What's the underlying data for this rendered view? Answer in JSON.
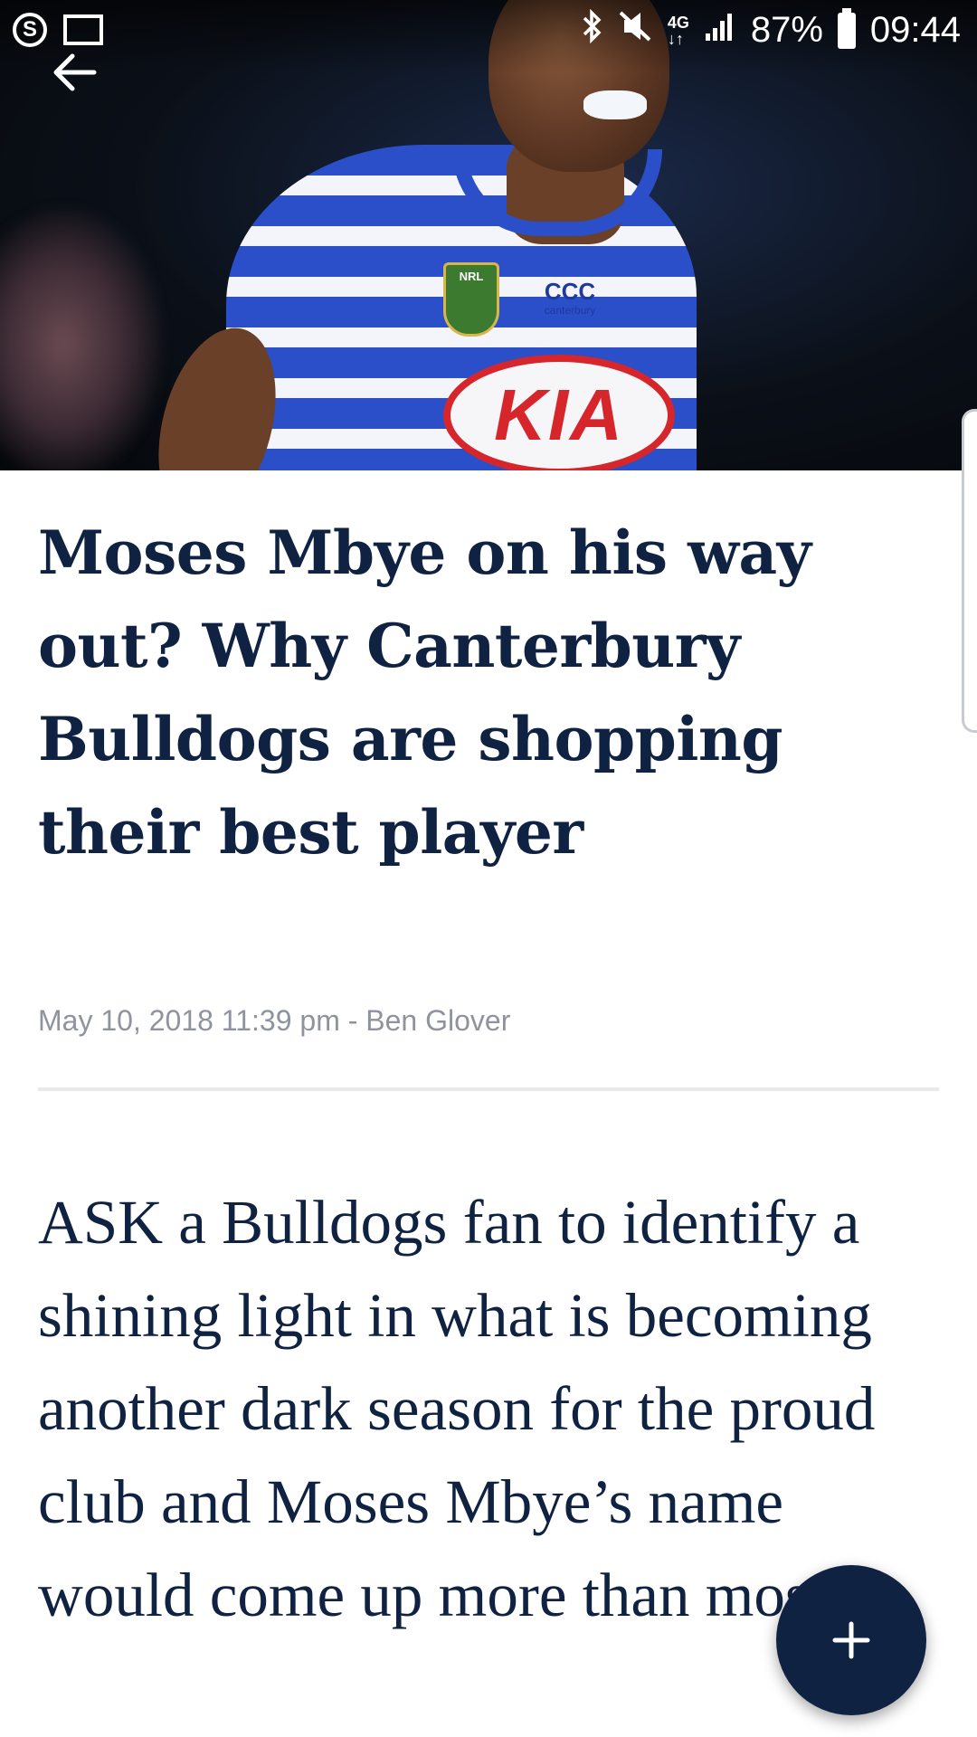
{
  "status_bar": {
    "battery": "87%",
    "time": "09:44",
    "network": "4G"
  },
  "article": {
    "headline": "Moses Mbye on his way out? Why Canterbury Bulldogs are shopping their best player",
    "date": "May 10, 2018 11:39 pm",
    "separator": " - ",
    "author": "Ben Glover",
    "body": "ASK a Bulldogs fan to identify a shining light in what is becoming another dark season for the proud club and Moses Mbye’s name would come up more than most."
  },
  "hero_image": {
    "sponsor": "KIA",
    "badge": "NRL",
    "brand": "canterbury"
  },
  "fab": {
    "label": "+"
  },
  "colors": {
    "accent": "#0f2242",
    "meta": "#8e939e",
    "divider": "#e7e9ef"
  },
  "icons": {
    "back": "arrow-left-icon",
    "fab": "plus-icon",
    "bluetooth": "bluetooth-icon",
    "mute": "mute-icon",
    "signal": "signal-icon",
    "battery": "battery-icon"
  }
}
